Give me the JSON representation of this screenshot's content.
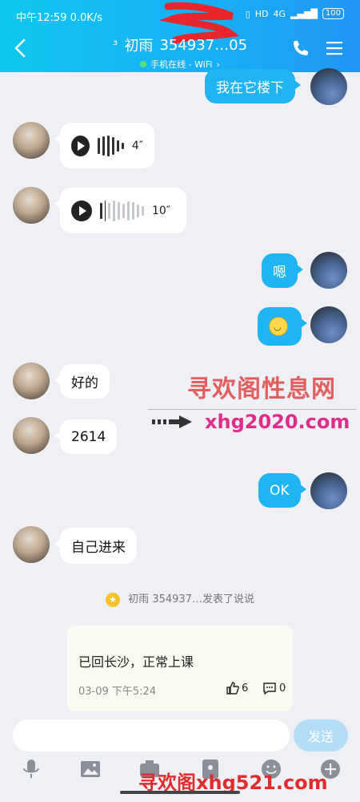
{
  "status_bar": {
    "time": "中午12:59",
    "speed": "0.0K/s",
    "battery": "100",
    "network": "4G",
    "hd": "HD"
  },
  "header": {
    "contact_name": "初雨",
    "contact_id": "354937…05",
    "presence": "手机在线 - WiFi",
    "presence_color": "#5fe26c"
  },
  "messages": [
    {
      "side": "right",
      "type": "text",
      "text": "我在它楼下"
    },
    {
      "side": "left",
      "type": "voice",
      "duration": "4″"
    },
    {
      "side": "left",
      "type": "voice",
      "duration": "10″"
    },
    {
      "side": "right",
      "type": "text",
      "text": "嗯"
    },
    {
      "side": "right",
      "type": "emoji",
      "emoji": "smile-emoji"
    },
    {
      "side": "left",
      "type": "text",
      "text": "好的"
    },
    {
      "side": "left",
      "type": "text",
      "text": "2614"
    },
    {
      "side": "right",
      "type": "text",
      "text": "OK"
    },
    {
      "side": "left",
      "type": "text",
      "text": "自己进来"
    }
  ],
  "moment_notice": {
    "name": "初雨",
    "id_and_action": "354937…发表了说说"
  },
  "moment_card": {
    "text": "已回长沙，正常上课",
    "date": "03-09 下午5:24",
    "likes": "6",
    "comments": "0"
  },
  "composer": {
    "send_label": "发送",
    "placeholder": ""
  },
  "watermarks": {
    "line1": "寻欢阁性息网",
    "line2": "xhg2020.com",
    "line3": "寻欢阁xhg521.com"
  },
  "colors": {
    "accent": "#21b4f2",
    "header_start": "#10c7f0",
    "header_end": "#2196f3",
    "background": "#eef0f5"
  }
}
